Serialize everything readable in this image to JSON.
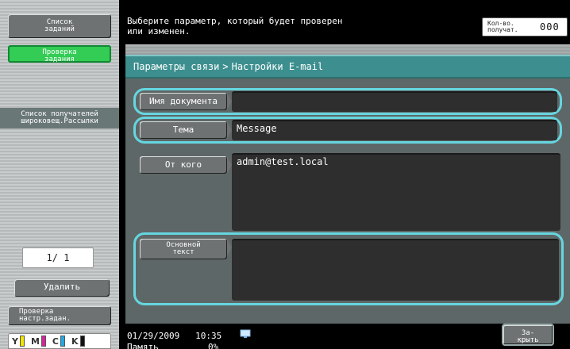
{
  "left": {
    "job_list_label": "Список\nзаданий",
    "check_job_label": "Проверка\nзадания",
    "recipient_list_title": "Список получателей\nшироковещ.Рассылки",
    "page_indicator": "1/ 1",
    "delete_label": "Удалить",
    "check_settings_label": "Проверка\nнастр.задан."
  },
  "toner": [
    {
      "label": "Y",
      "color": "#f2e600"
    },
    {
      "label": "M",
      "color": "#d6249a"
    },
    {
      "label": "C",
      "color": "#1fa9e6"
    },
    {
      "label": "K",
      "color": "#111111"
    }
  ],
  "header": {
    "message": "Выберите параметр, который будет проверен\nили изменен.",
    "count_label": "Кол-во.\nполучат.",
    "count_value": "000"
  },
  "breadcrumb": {
    "parent": "Параметры связи",
    "separator": ">",
    "current": "Настройки E-mail"
  },
  "fields": {
    "document_name": {
      "label": "Имя документа",
      "value": ""
    },
    "subject": {
      "label": "Тема",
      "value": "Message"
    },
    "from": {
      "label": "От кого",
      "value": "admin@test.local"
    },
    "body": {
      "label": "Основной\nтекст",
      "value": ""
    }
  },
  "status": {
    "date": "01/29/2009",
    "time": "10:35",
    "memory_label": "Память",
    "memory_value": "0%",
    "close_label": "За-\nкрыть"
  },
  "colors": {
    "highlight": "#66d6e0",
    "breadcrumb_bg": "#3d8f8f",
    "active_button": "#33cc55"
  }
}
